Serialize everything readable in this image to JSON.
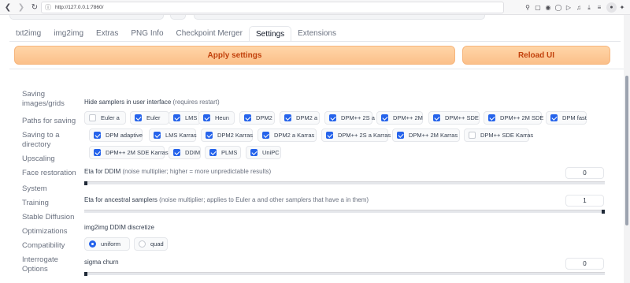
{
  "browser": {
    "url": "http://127.0.0.1:7860/",
    "back_icon": "chevron-left",
    "forward_icon": "chevron-right",
    "reload_icon": "reload",
    "tool_icons": [
      "search-icon",
      "screenshot-icon",
      "camera-icon",
      "vpn-icon",
      "send-icon",
      "media-icon",
      "download-icon",
      "menu-icon",
      "profile-icon",
      "extensions-icon"
    ]
  },
  "tabs": [
    {
      "label": "txt2img"
    },
    {
      "label": "img2img"
    },
    {
      "label": "Extras"
    },
    {
      "label": "PNG Info"
    },
    {
      "label": "Checkpoint Merger"
    },
    {
      "label": "Settings",
      "active": true
    },
    {
      "label": "Extensions"
    }
  ],
  "actions": {
    "apply": "Apply settings",
    "reload": "Reload UI"
  },
  "sidebar": [
    "Saving images/grids",
    "Paths for saving",
    "Saving to a directory",
    "Upscaling",
    "Face restoration",
    "System",
    "Training",
    "Stable Diffusion",
    "Optimizations",
    "Compatibility",
    "Interrogate Options"
  ],
  "hide_samplers": {
    "label": "Hide samplers in user interface",
    "note": "(requires restart)",
    "options": [
      {
        "label": "Euler a",
        "checked": false
      },
      {
        "label": "Euler",
        "checked": true
      },
      {
        "label": "LMS",
        "checked": true
      },
      {
        "label": "Heun",
        "checked": true
      },
      {
        "label": "DPM2",
        "checked": true
      },
      {
        "label": "DPM2 a",
        "checked": true
      },
      {
        "label": "DPM++ 2S a",
        "checked": true
      },
      {
        "label": "DPM++ 2M",
        "checked": true
      },
      {
        "label": "DPM++ SDE",
        "checked": true
      },
      {
        "label": "DPM++ 2M SDE",
        "checked": true
      },
      {
        "label": "DPM fast",
        "checked": true
      },
      {
        "label": "DPM adaptive",
        "checked": true
      },
      {
        "label": "LMS Karras",
        "checked": true
      },
      {
        "label": "DPM2 Karras",
        "checked": true
      },
      {
        "label": "DPM2 a Karras",
        "checked": true
      },
      {
        "label": "DPM++ 2S a Karras",
        "checked": true
      },
      {
        "label": "DPM++ 2M Karras",
        "checked": true
      },
      {
        "label": "DPM++ SDE Karras",
        "checked": false
      },
      {
        "label": "DPM++ 2M SDE Karras",
        "checked": true
      },
      {
        "label": "DDIM",
        "checked": true
      },
      {
        "label": "PLMS",
        "checked": true
      },
      {
        "label": "UniPC",
        "checked": true
      }
    ]
  },
  "eta_ddim": {
    "label": "Eta for DDIM",
    "note": "(noise multiplier; higher = more unpredictable results)",
    "value": "0",
    "fraction": 0
  },
  "eta_ancestral": {
    "label": "Eta for ancestral samplers",
    "note": "(noise multiplier; applies to Euler a and other samplers that have a in them)",
    "value": "1",
    "fraction": 1
  },
  "ddim_discretize": {
    "label": "img2img DDIM discretize",
    "options": [
      {
        "label": "uniform",
        "selected": true
      },
      {
        "label": "quad",
        "selected": false
      }
    ]
  },
  "sigma_churn": {
    "label": "sigma churn",
    "value": "0",
    "fraction": 0
  },
  "colors": {
    "accent": "#2563eb",
    "button_orange": "#fbc08a",
    "button_text": "#c2410c"
  }
}
